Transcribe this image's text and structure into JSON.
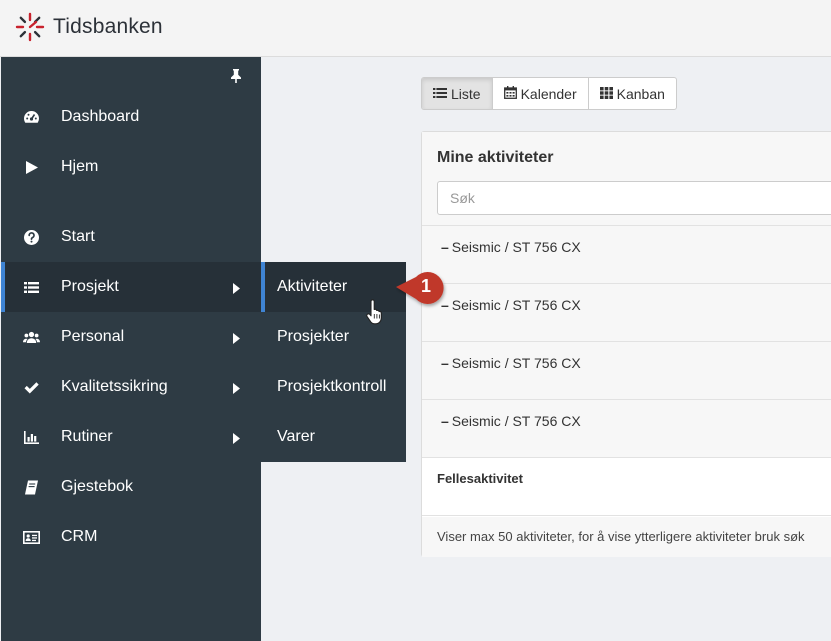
{
  "app": {
    "brand": "Tidsbanken",
    "colors": {
      "sidebar": "#2e3b44",
      "sidebar_active": "#263038",
      "accent": "#3f84d3",
      "callout": "#c0392b",
      "logo_red": "#c8222d"
    }
  },
  "sidebar": {
    "items": [
      {
        "label": "Dashboard",
        "icon": "dashboard-icon"
      },
      {
        "label": "Hjem",
        "icon": "play-icon"
      },
      {
        "label": "Start",
        "icon": "question-icon"
      },
      {
        "label": "Prosjekt",
        "icon": "list-icon",
        "active": true,
        "has_submenu": true
      },
      {
        "label": "Personal",
        "icon": "users-icon",
        "has_submenu": true
      },
      {
        "label": "Kvalitetssikring",
        "icon": "check-icon",
        "has_submenu": true
      },
      {
        "label": "Rutiner",
        "icon": "bar-chart-icon",
        "has_submenu": true
      },
      {
        "label": "Gjestebok",
        "icon": "book-icon"
      },
      {
        "label": "CRM",
        "icon": "id-card-icon"
      }
    ]
  },
  "submenu": {
    "items": [
      {
        "label": "Aktiviteter",
        "active": true
      },
      {
        "label": "Prosjekter"
      },
      {
        "label": "Prosjektkontroll"
      },
      {
        "label": "Varer"
      }
    ]
  },
  "view_toggle": {
    "buttons": [
      {
        "label": "Liste",
        "icon": "list-icon",
        "active": true
      },
      {
        "label": "Kalender",
        "icon": "calendar-icon"
      },
      {
        "label": "Kanban",
        "icon": "grid-icon"
      }
    ]
  },
  "panel": {
    "title": "Mine aktiviteter",
    "search_placeholder": "Søk",
    "activities": [
      {
        "prefix": "–",
        "label": "Seismic / ST 756 CX"
      },
      {
        "prefix": "–",
        "label": "Seismic / ST 756 CX"
      },
      {
        "prefix": "–",
        "label": "Seismic / ST 756 CX"
      },
      {
        "prefix": "–",
        "label": "Seismic / ST 756 CX"
      }
    ],
    "shared_heading": "Fellesaktivitet",
    "footer_note": "Viser max 50 aktiviteter, for å vise ytterligere aktiviteter bruk søk"
  },
  "callout": {
    "number": "1"
  }
}
